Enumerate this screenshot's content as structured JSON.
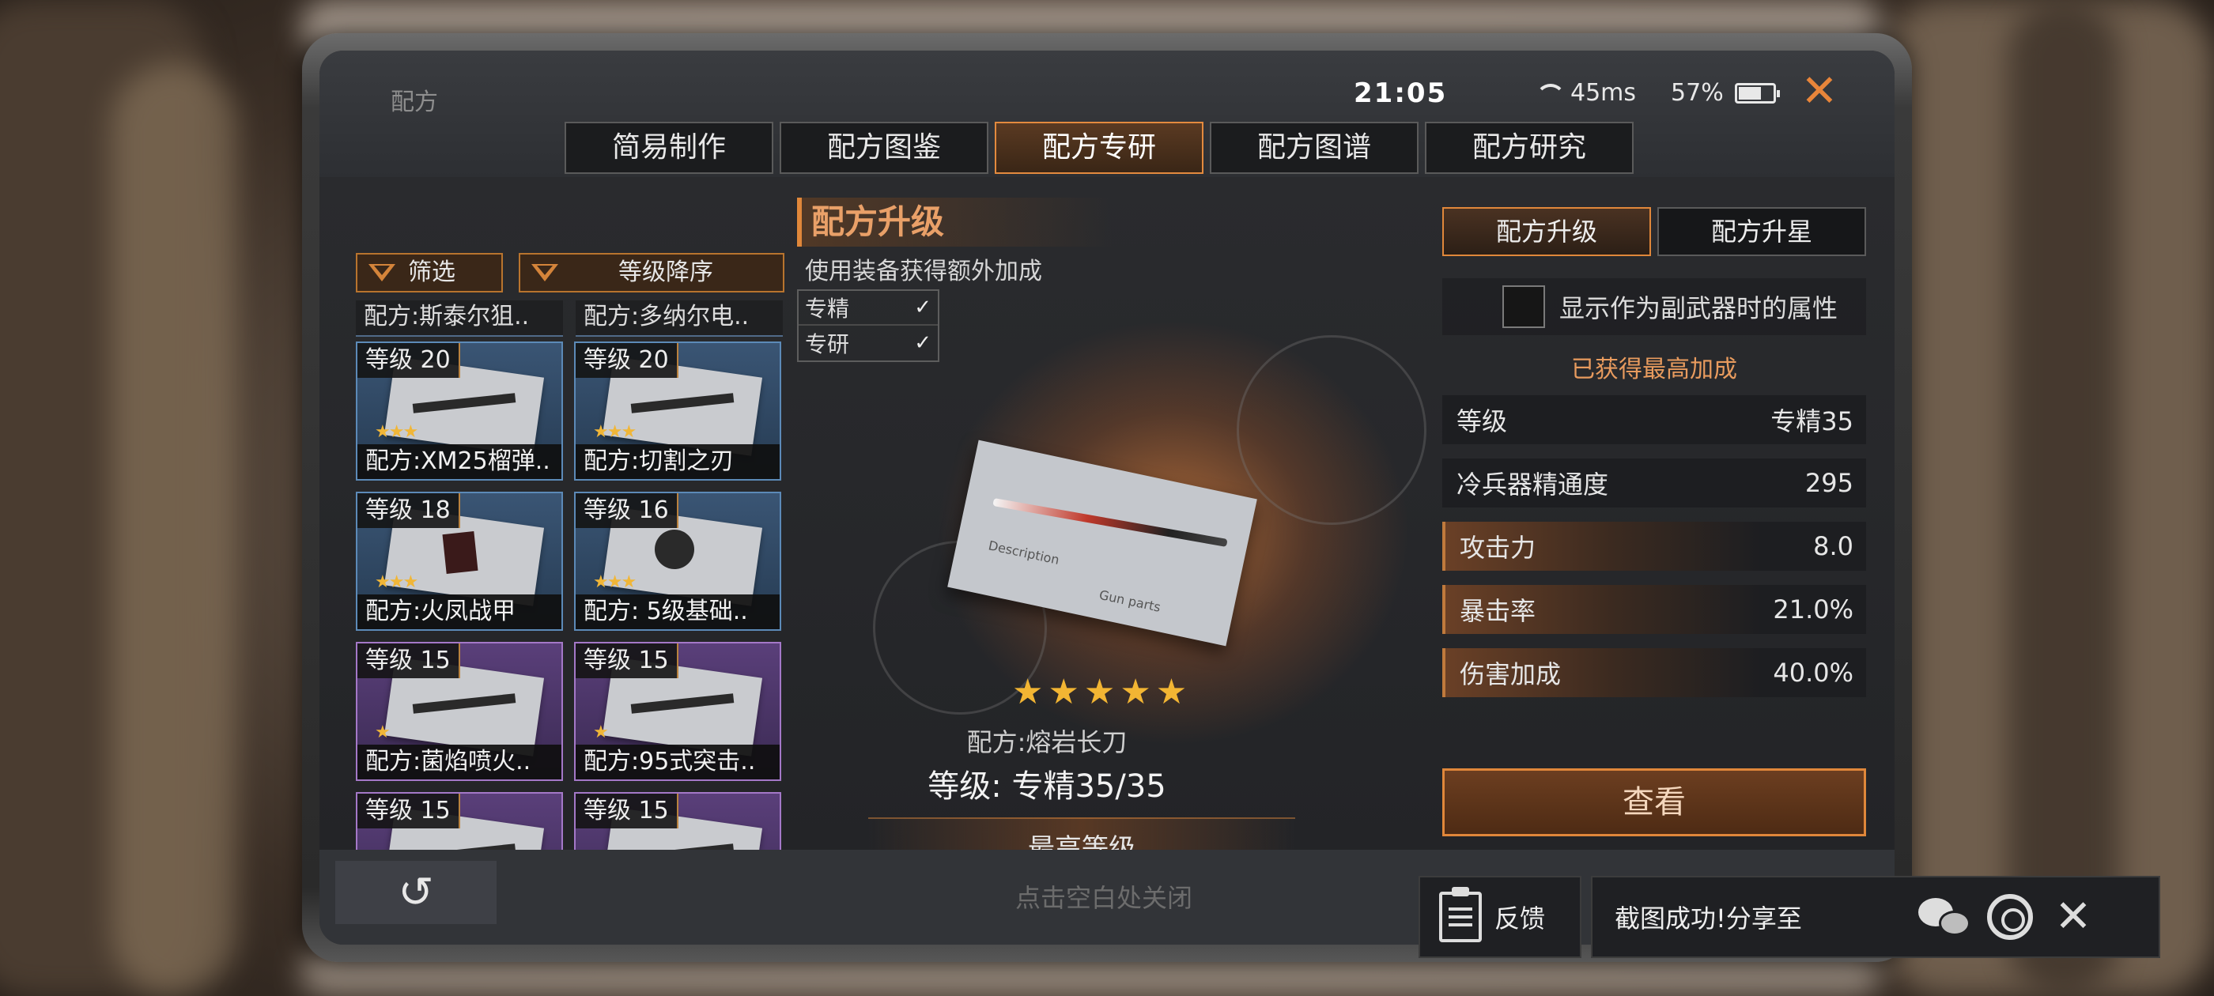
{
  "window": {
    "title": "配方",
    "clock": "21:05",
    "ping": "45ms",
    "battery": "57%"
  },
  "tabs": [
    "简易制作",
    "配方图鉴",
    "配方专研",
    "配方图谱",
    "配方研究"
  ],
  "active_tab": "配方专研",
  "filters": {
    "filter_label": "筛选",
    "sort_label": "等级降序"
  },
  "list": {
    "top_partial": [
      "配方:斯泰尔狙..",
      "配方:多纳尔电.."
    ],
    "cards": [
      {
        "level": "等级 20",
        "name": "配方:XM25榴弹..",
        "stars": 3,
        "rarity": "blue"
      },
      {
        "level": "等级 20",
        "name": "配方:切割之刃",
        "stars": 3,
        "rarity": "blue"
      },
      {
        "level": "等级 18",
        "name": "配方:火凤战甲",
        "stars": 3,
        "rarity": "blue"
      },
      {
        "level": "等级 16",
        "name": "配方: 5级基础..",
        "stars": 3,
        "rarity": "blue"
      },
      {
        "level": "等级 15",
        "name": "配方:菌焰喷火..",
        "stars": 1,
        "rarity": "purple"
      },
      {
        "level": "等级 15",
        "name": "配方:95式突击..",
        "stars": 1,
        "rarity": "purple"
      },
      {
        "level": "等级 15",
        "name": "",
        "stars": 0,
        "rarity": "purple"
      },
      {
        "level": "等级 15",
        "name": "",
        "stars": 0,
        "rarity": "purple"
      }
    ]
  },
  "detail": {
    "section_title": "配方升级",
    "subtitle": "使用装备获得额外加成",
    "checks": [
      {
        "label": "专精",
        "mark": "✓"
      },
      {
        "label": "专研",
        "mark": "✓"
      }
    ],
    "blueprint_text_1": "Description",
    "blueprint_text_2": "Gun parts",
    "stars": "★★★★★",
    "item_name": "配方:熔岩长刀",
    "item_level": "等级: 专精35/35",
    "max_level_label": "最高等级"
  },
  "right_panel": {
    "tabs": [
      "配方升级",
      "配方升星"
    ],
    "subweapon_label": "显示作为副武器时的属性",
    "max_bonus": "已获得最高加成",
    "stats": [
      {
        "label": "等级",
        "value": "专精35",
        "highlight": false
      },
      {
        "label": "冷兵器精通度",
        "value": "295",
        "highlight": false
      },
      {
        "label": "攻击力",
        "value": "8.0",
        "highlight": true
      },
      {
        "label": "暴击率",
        "value": "21.0%",
        "highlight": true
      },
      {
        "label": "伤害加成",
        "value": "40.0%",
        "highlight": true
      }
    ],
    "view_button": "查看"
  },
  "bottom": {
    "back_icon": "↺",
    "close_hint": "点击空白处关闭"
  },
  "share_toast": {
    "feedback_label": "反馈",
    "share_text": "截图成功!分享至",
    "close": "✕"
  },
  "colors": {
    "accent": "#e0873a",
    "star": "#f2b533",
    "blue_rarity": "#5c8ab8",
    "purple_rarity": "#a478c8"
  }
}
